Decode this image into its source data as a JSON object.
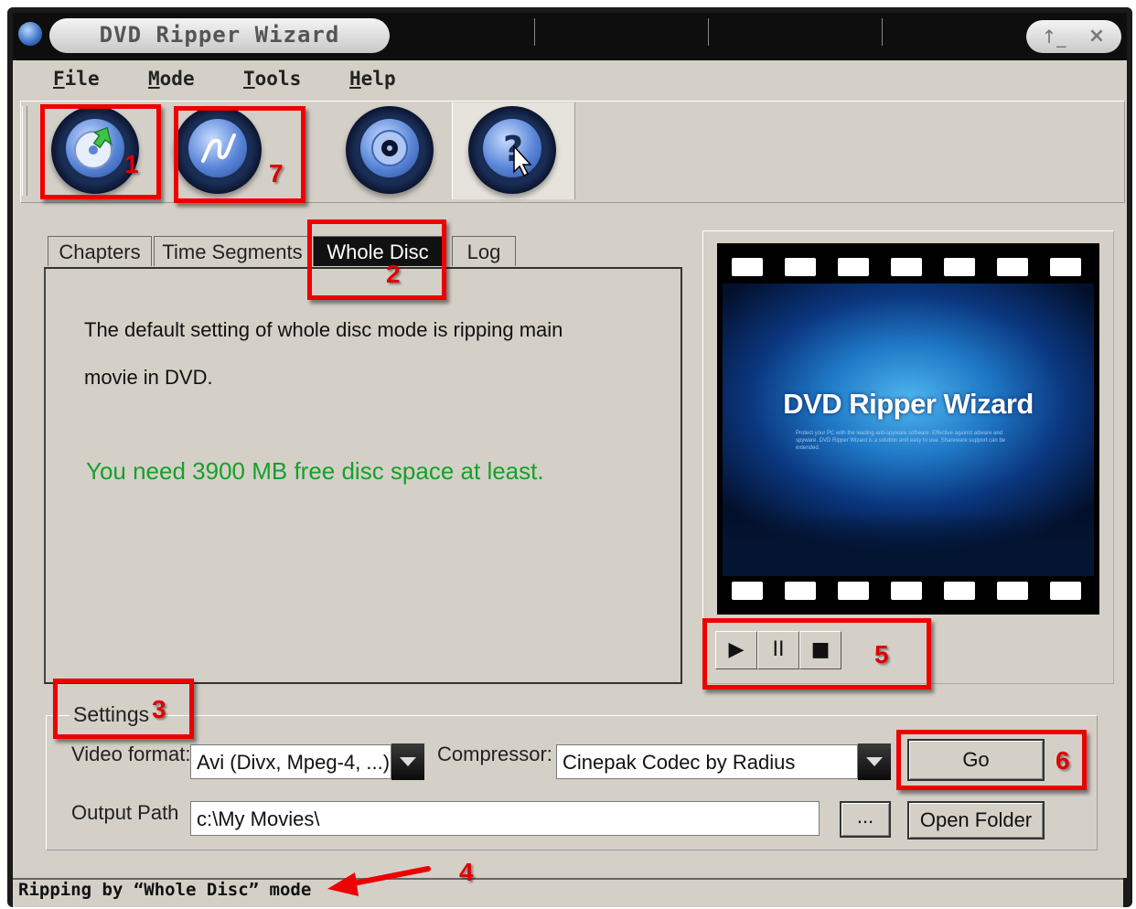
{
  "window": {
    "title": "DVD Ripper Wizard",
    "min_label": "↑_",
    "close_label": "×"
  },
  "menu": [
    {
      "key": "F",
      "rest": "ile"
    },
    {
      "key": "M",
      "rest": "ode"
    },
    {
      "key": "T",
      "rest": "ools"
    },
    {
      "key": "H",
      "rest": "elp"
    }
  ],
  "toolbar": {
    "buttons": [
      {
        "icon": "disc-load-icon"
      },
      {
        "icon": "wave-encode-icon"
      },
      {
        "icon": "settings-disc-icon"
      },
      {
        "icon": "help-icon"
      }
    ]
  },
  "tabs": [
    {
      "label": "Chapters"
    },
    {
      "label": "Time Segments"
    },
    {
      "label": "Whole Disc",
      "active": true
    },
    {
      "label": "Log"
    }
  ],
  "panel": {
    "line1": "The default setting of whole disc mode is ripping main",
    "line2": "movie in DVD.",
    "space_note": "You need 3900 MB free disc space at least.",
    "space_color": "#16a02a"
  },
  "preview": {
    "title": "DVD Ripper Wizard",
    "small_text": "Protect your PC with the leading anti-spyware software. Effective against adware and spyware. DVD Ripper Wizard is a solution and easy to use. Shareware support can be extended."
  },
  "controls": {
    "play": "▶",
    "pause": "II",
    "stop": "■"
  },
  "settings": {
    "group_label": "Settings",
    "video_format_label": "Video format:",
    "video_format_value": "Avi (Divx, Mpeg-4, ...)",
    "compressor_label": "Compressor:",
    "compressor_value": "Cinepak Codec by Radius",
    "go_label": "Go",
    "output_path_label": "Output Path",
    "output_path_value": "c:\\My Movies\\",
    "browse_label": "...",
    "open_folder_label": "Open Folder"
  },
  "status": {
    "text": "Ripping by “Whole Disc” mode"
  },
  "annotations": {
    "color": "#e00000",
    "n1": "1",
    "n2": "2",
    "n3": "3",
    "n4": "4",
    "n5": "5",
    "n6": "6",
    "n7": "7"
  }
}
